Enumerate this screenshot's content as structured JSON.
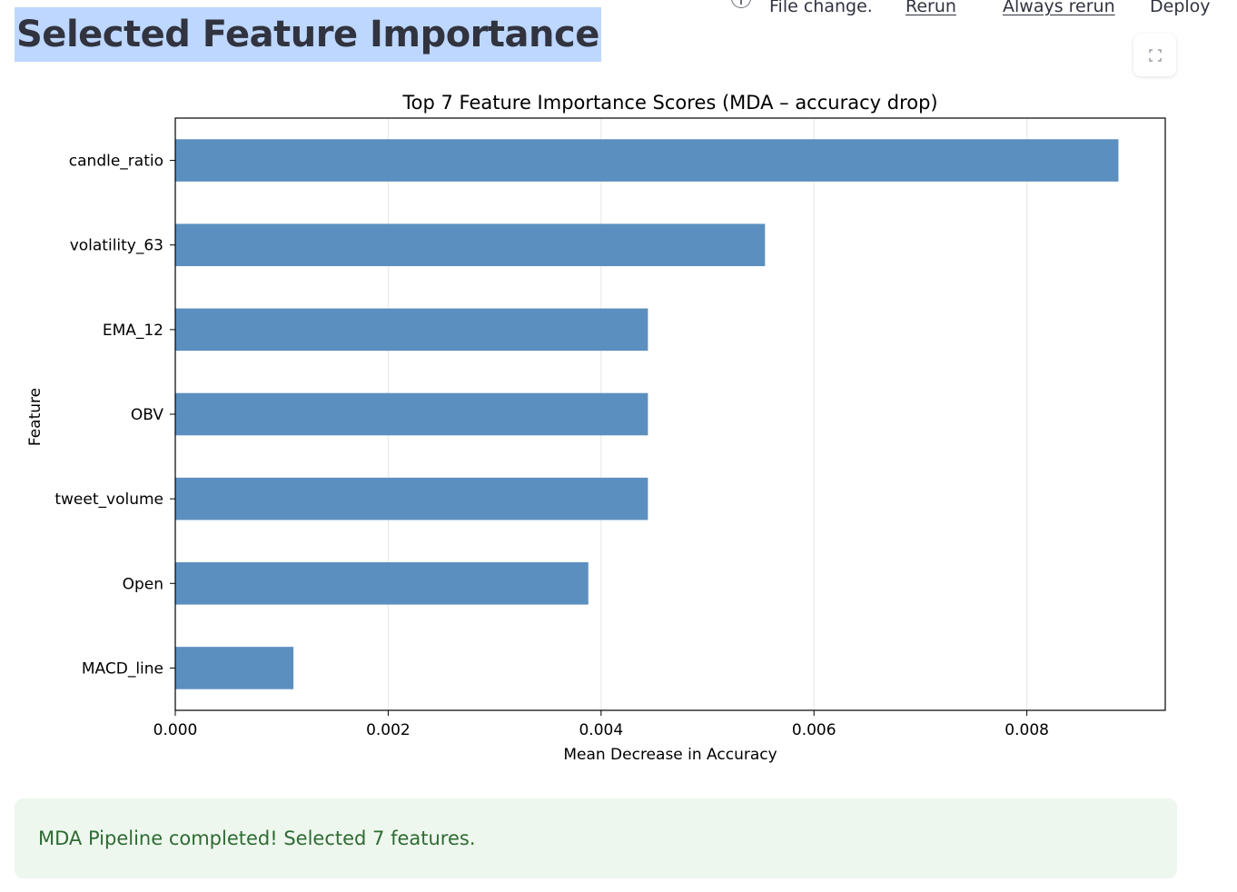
{
  "page": {
    "title": "Selected Feature Importance"
  },
  "toolbar": {
    "file_change_label": "File change.",
    "rerun_label": "Rerun",
    "always_rerun_label": "Always rerun",
    "deploy_label": "Deploy",
    "info_icon": "info-icon",
    "fullscreen_icon": "fullscreen-icon"
  },
  "chart_data": {
    "type": "bar",
    "orientation": "horizontal",
    "title": "Top 7 Feature Importance Scores (MDA – accuracy drop)",
    "xlabel": "Mean Decrease in Accuracy",
    "ylabel": "Feature",
    "categories": [
      "candle_ratio",
      "volatility_63",
      "EMA_12",
      "OBV",
      "tweet_volume",
      "Open",
      "MACD_line"
    ],
    "values": [
      0.00886,
      0.00554,
      0.00444,
      0.00444,
      0.00444,
      0.00388,
      0.00111
    ],
    "xlim": [
      0,
      0.0093
    ],
    "xticks": [
      0.0,
      0.002,
      0.004,
      0.006,
      0.008
    ],
    "xtick_labels": [
      "0.000",
      "0.002",
      "0.004",
      "0.006",
      "0.008"
    ],
    "grid": "x",
    "bar_color": "#5b8fbf"
  },
  "status": {
    "message": "MDA Pipeline completed! Selected 7 features.",
    "color": "#2e6b33"
  }
}
